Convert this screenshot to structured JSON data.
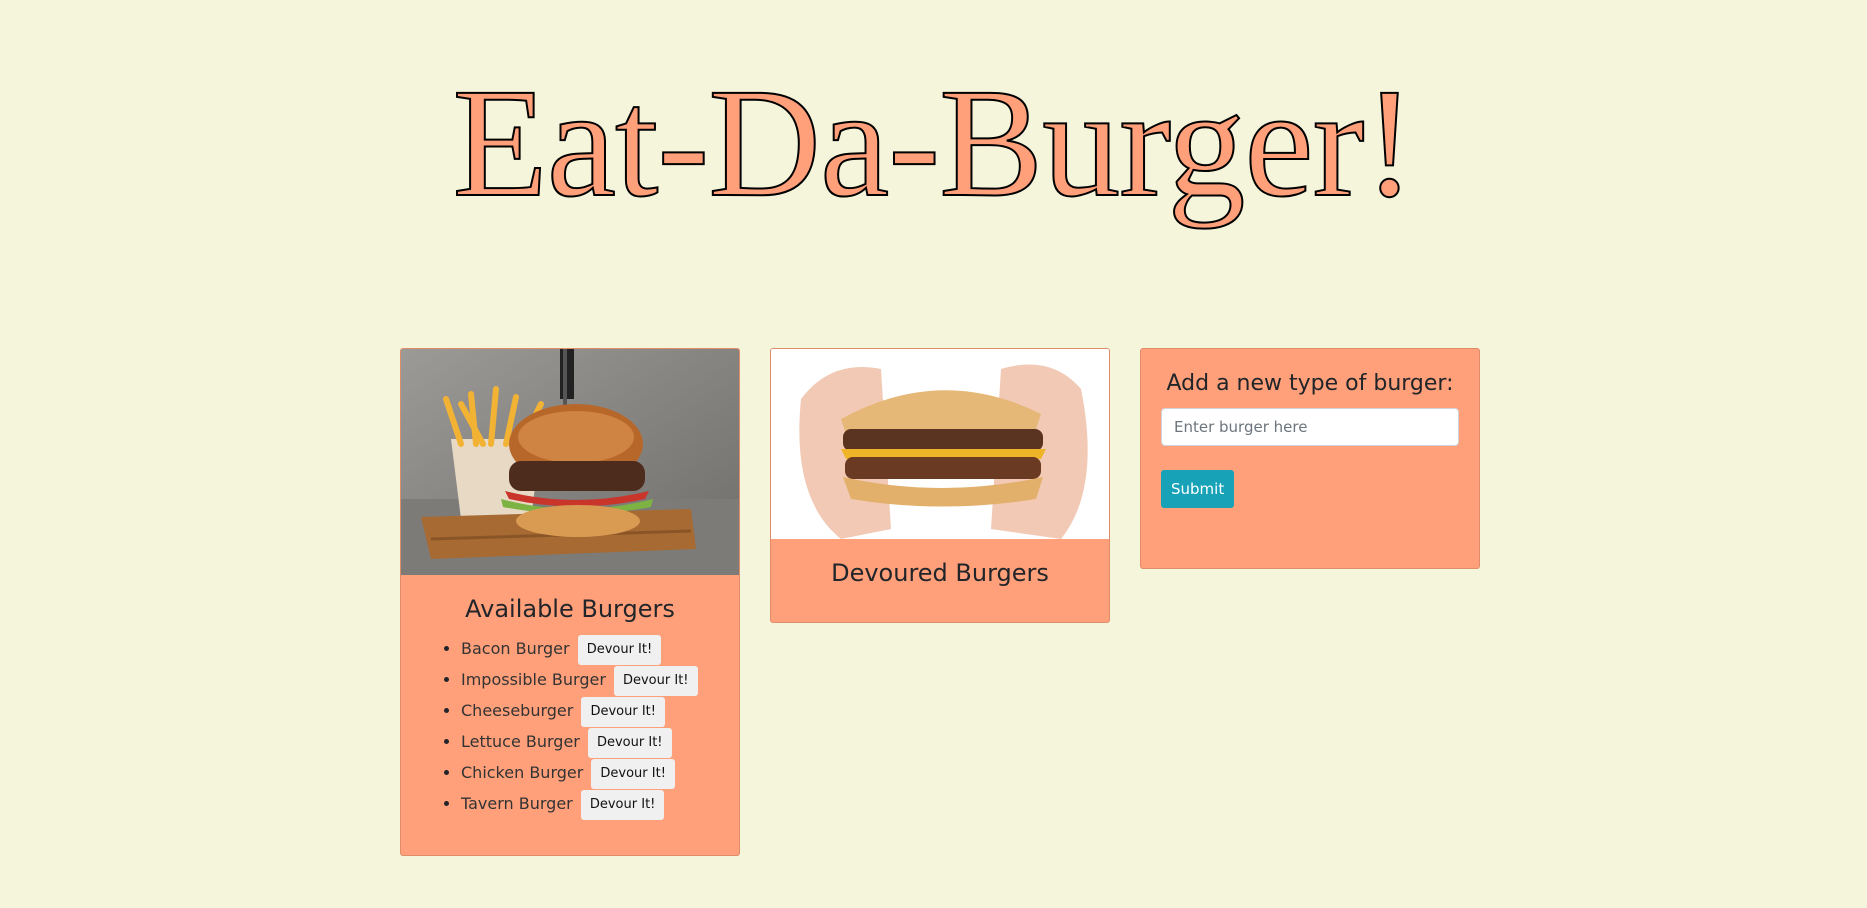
{
  "page": {
    "title": "Eat-Da-Burger!"
  },
  "colors": {
    "background": "#f5f5dc",
    "card": "#ffa07a",
    "title_fill": "#ffa07a",
    "submit": "#17a2b8"
  },
  "available": {
    "title": "Available Burgers",
    "image": "burger-with-fries-image",
    "items": [
      {
        "name": "Bacon Burger",
        "button": "Devour It!"
      },
      {
        "name": "Impossible Burger",
        "button": "Devour It!"
      },
      {
        "name": "Cheeseburger",
        "button": "Devour It!"
      },
      {
        "name": "Lettuce Burger",
        "button": "Devour It!"
      },
      {
        "name": "Chicken Burger",
        "button": "Devour It!"
      },
      {
        "name": "Tavern Burger",
        "button": "Devour It!"
      }
    ]
  },
  "devoured": {
    "title": "Devoured Burgers",
    "image": "hands-holding-bitten-burger-image"
  },
  "add": {
    "title": "Add a new type of burger:",
    "input_placeholder": "Enter burger here",
    "input_value": "",
    "submit_label": "Submit"
  }
}
